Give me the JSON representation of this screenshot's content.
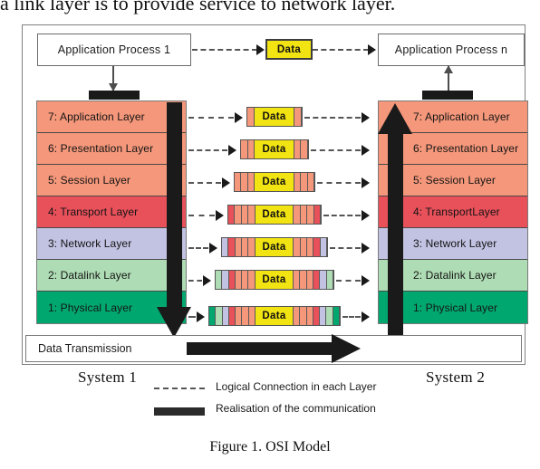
{
  "page": {
    "top_sentence": "a link layer is to provide service to network layer.",
    "caption": "Figure 1. OSI Model"
  },
  "processes": {
    "left_label": "Application Process 1",
    "right_label": "Application Process n",
    "top_packet_label": "Data"
  },
  "colors": {
    "application": "#F4977A",
    "presentation": "#F4977A",
    "session": "#F4977A",
    "transport": "#E8505A",
    "network": "#C2C2E2",
    "datalink": "#AEDCB4",
    "physical": "#00A870",
    "payload": "#F2E312",
    "arrow": "#1a1a1a",
    "frame": "#7a7a7a"
  },
  "layers": [
    {
      "num": "7",
      "name": "7: Application Layer",
      "color": "#F4977A",
      "bands": 1
    },
    {
      "num": "6",
      "name": "6: Presentation Layer",
      "color": "#F4977A",
      "bands": 2
    },
    {
      "num": "5",
      "name": "5: Session Layer",
      "color": "#F4977A",
      "bands": 3
    },
    {
      "num": "4",
      "name": "4: Transport Layer",
      "color": "#E8505A",
      "bands": 4
    },
    {
      "num": "3",
      "name": "3: Network Layer",
      "color": "#C2C2E2",
      "bands": 5
    },
    {
      "num": "2",
      "name": "2: Datalink Layer",
      "color": "#AEDCB4",
      "bands": 6
    },
    {
      "num": "1",
      "name": "1: Physical Layer",
      "color": "#00A870",
      "bands": 7
    }
  ],
  "layers_right": [
    {
      "name": "7: Application Layer"
    },
    {
      "name": "6: Presentation Layer"
    },
    {
      "name": "5: Session Layer"
    },
    {
      "name": "4: TransportLayer"
    },
    {
      "name": "3: Network Layer"
    },
    {
      "name": "2: Datalink Layer"
    },
    {
      "name": "1: Physical Layer"
    }
  ],
  "packets": [
    {
      "label": "Data"
    },
    {
      "label": "Data"
    },
    {
      "label": "Data"
    },
    {
      "label": "Data"
    },
    {
      "label": "Data"
    },
    {
      "label": "Data"
    },
    {
      "label": "Data"
    }
  ],
  "transmission": {
    "label": "Data Transmission"
  },
  "systems": {
    "left": "System 1",
    "right": "System 2"
  },
  "legend": {
    "dashed_label": "Logical Connection  in  each Layer",
    "solid_label": "Realisation of the  communication"
  }
}
